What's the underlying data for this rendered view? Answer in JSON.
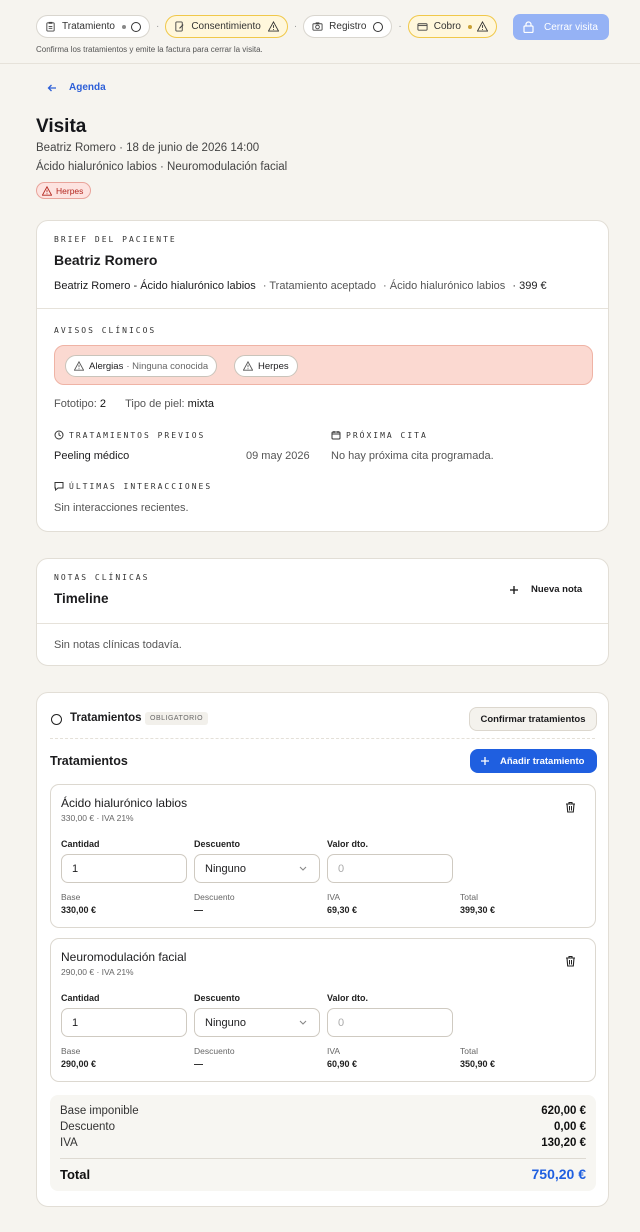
{
  "steps": [
    {
      "label": "Tratamiento",
      "state": "pending"
    },
    {
      "label": "Consentimiento",
      "state": "warning"
    },
    {
      "label": "Registro",
      "state": "pending"
    },
    {
      "label": "Cobro",
      "state": "warning"
    }
  ],
  "step_separator": "·",
  "close_visit_label": "Cerrar visita",
  "hint": "Confirma los tratamientos y emite la factura para cerrar la visita.",
  "back_label": "Agenda",
  "visit": {
    "title": "Visita",
    "subtitle": "Beatriz Romero · 18 de junio de 2026 14:00",
    "treatments_line": "Ácido hialurónico labios · Neuromodulación facial",
    "badge": "Herpes"
  },
  "brief": {
    "section_label": "BRIEF DEL PACIENTE",
    "patient_name": "Beatriz Romero",
    "proposal_title": "Beatriz Romero - Ácido hialurónico labios",
    "proposal_status": "· Tratamiento aceptado",
    "proposal_treatment": "· Ácido hialurónico labios",
    "proposal_price": "· 399 €",
    "alerts_label": "AVISOS CLÍNICOS",
    "alert_allergy_title": "Alergias",
    "alert_allergy_detail": "· Ninguna conocida",
    "alert_herpes": "Herpes",
    "phototype_label": "Fototipo:",
    "phototype_value": "2",
    "skin_label": "Tipo de piel:",
    "skin_value": "mixta",
    "previous_label": "TRATAMIENTOS PREVIOS",
    "previous_name": "Peeling médico",
    "previous_date": "09 may 2026",
    "next_label": "PRÓXIMA CITA",
    "next_value": "No hay próxima cita programada.",
    "interactions_label": "ÚLTIMAS INTERACCIONES",
    "interactions_value": "Sin interacciones recientes."
  },
  "notes": {
    "section_label": "NOTAS CLÍNICAS",
    "title": "Timeline",
    "new_note": "Nueva nota",
    "empty": "Sin notas clínicas todavía."
  },
  "treatments": {
    "step_title": "Tratamientos",
    "required_badge": "OBLIGATORIO",
    "confirm_button": "Confirmar tratamientos",
    "list_title": "Tratamientos",
    "add_button": "Añadir tratamiento",
    "labels": {
      "quantity": "Cantidad",
      "discount": "Descuento",
      "discount_value": "Valor dto.",
      "base": "Base",
      "discount_sum": "Descuento",
      "vat": "IVA",
      "total": "Total"
    },
    "items": [
      {
        "name": "Ácido hialurónico labios",
        "meta": "330,00 € · IVA 21%",
        "quantity": "1",
        "discount": "Ninguno",
        "discount_value_placeholder": "0",
        "base": "330,00 €",
        "discount_amount": "—",
        "vat": "69,30 €",
        "total": "399,30 €"
      },
      {
        "name": "Neuromodulación facial",
        "meta": "290,00 € · IVA 21%",
        "quantity": "1",
        "discount": "Ninguno",
        "discount_value_placeholder": "0",
        "base": "290,00 €",
        "discount_amount": "—",
        "vat": "60,90 €",
        "total": "350,90 €"
      }
    ],
    "summary": {
      "base_label": "Base imponible",
      "base_value": "620,00 €",
      "discount_label": "Descuento",
      "discount_value": "0,00 €",
      "vat_label": "IVA",
      "vat_value": "130,20 €",
      "total_label": "Total",
      "total_value": "750,20 €"
    }
  },
  "colors": {
    "accent": "#1f5fe0",
    "warning": "#f0c84a",
    "alert_bg": "#fbd9d1",
    "alert_text": "#b3261e",
    "background": "#f6f4ef"
  }
}
